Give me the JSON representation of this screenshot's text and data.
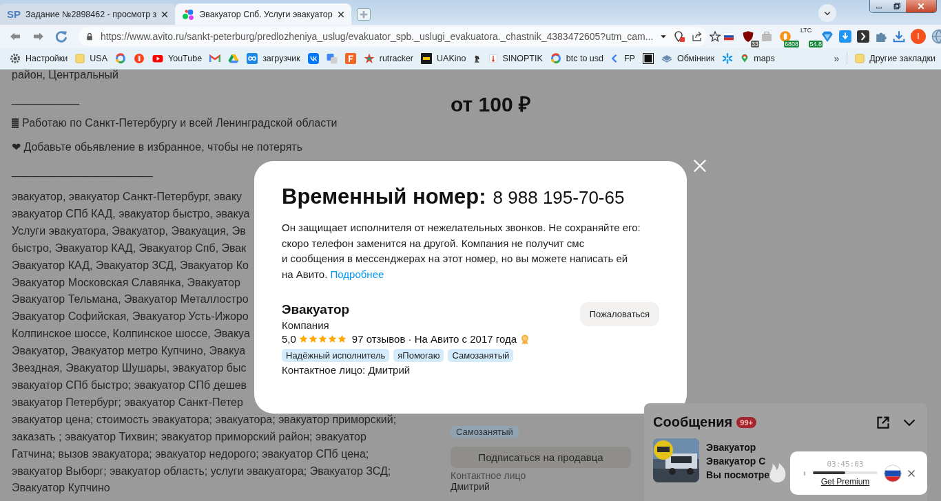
{
  "tabs": [
    {
      "favicon_text": "SP",
      "title": "Задание №2898462 - просмотр з",
      "selected": false
    },
    {
      "title": "Эвакуатор Спб. Услуги эвакуатор",
      "selected": true
    }
  ],
  "address_bar": {
    "url": "https://www.avito.ru/sankt-peterburg/predlozheniya_uslug/evakuator_spb._uslugi_evakuatora._chastnik_4383472605?utm_cam..."
  },
  "extensions": {
    "blocker_count": "33",
    "btc_price": "6808",
    "coin_label": "LTC",
    "coin_price": "54.8",
    "profile_initial": "I"
  },
  "bookmarks": [
    {
      "kind": "link",
      "label": "Настройки"
    },
    {
      "kind": "link",
      "label": "USA"
    },
    {
      "kind": "icon"
    },
    {
      "kind": "icon"
    },
    {
      "kind": "link",
      "label": "YouTube"
    },
    {
      "kind": "icon"
    },
    {
      "kind": "icon"
    },
    {
      "kind": "link",
      "label": "загрузчик"
    },
    {
      "kind": "icon"
    },
    {
      "kind": "icon"
    },
    {
      "kind": "icon"
    },
    {
      "kind": "link",
      "label": "rutracker"
    },
    {
      "kind": "link",
      "label": "UAKino"
    },
    {
      "kind": "icon"
    },
    {
      "kind": "link",
      "label": "SINOPTIK"
    },
    {
      "kind": "link",
      "label": "btc to usd"
    },
    {
      "kind": "link",
      "label": "FP"
    },
    {
      "kind": "icon"
    },
    {
      "kind": "link",
      "label": "Обмінник"
    },
    {
      "kind": "icon"
    },
    {
      "kind": "link",
      "label": "maps"
    }
  ],
  "bookmarks_more": "»",
  "other_bookmarks": "Другие закладки",
  "listing": {
    "intro": [
      {
        "kind": "text",
        "text": "район, Центральный"
      },
      {
        "kind": "text",
        "text": "___________"
      },
      {
        "kind": "note",
        "text": "Работаю по Санкт-Петербургу и всей Ленинградской области"
      },
      {
        "kind": "text",
        "text": "❤ Добавьте обьявление в избранное, чтобы не потерять"
      },
      {
        "kind": "text",
        "text": "_______________________"
      }
    ],
    "keywords": [
      "эвакуатор, эвакуатор Санкт-Петербург, эваку",
      "эвакуатор СПб КАД, эвакуатор быстро, эвакуа",
      "Услуги эвакуатора, Эвакуатор, Эвакуация, Эв",
      "быстро, Эвакуатор КАД, Эвакуатор Спб, Эвак",
      "Эвакуатор КАД, Эвакуатор ЗСД, Эвакуатор Ко",
      "Эвакуатор Московская Славянка, Эвакуатор",
      "Эвакуатор Тельмана, Эвакуатор Металлостро",
      "Эвакуатор Софийская, Эвакуатор Усть-Ижоро",
      "Колпинское шоссе, Колпинское шоссе, Эвакуа",
      "Эвакуатор, Эвакуатор метро Купчино, Эвакуа",
      "Звездная, Эвакуатор Шушары, эвакуатор быс",
      "эвакуатор СПб быстро; эвакуатор СПб дешев",
      "эвакуатор Петербург; эвакуатор Санкт-Петер",
      "эвакуатор цена; стоимость эвакуатора; эвакуатора; эвакуатор приморский;",
      "заказать ; эвакуатор Тихвин; эвакуатор приморский район; эвакуатор",
      "Гатчина; вызов эвакуатора; эвакуатор недорого; эвакуатор СПб цена;",
      "эвакуатор Выборг; эвакуатор область; услуги эвакуатора; Эвакуатор ЗСД;",
      "Эвакуатор Купчино"
    ],
    "price": "от 100 ₽",
    "tag": "Самозанятый",
    "subscribe_button": "Подписаться на продавца",
    "contact_label": "Контактное лицо",
    "contact_name": "Дмитрий"
  },
  "modal": {
    "title": "Временный номер:",
    "phone": "8 988 195-70-65",
    "text": "Он защищает исполнителя от нежелательных звонков. Не сохраняйте его:\nскоро телефон заменится на другой. Компания не получит смс\nи сообщения в мессенджерах на этот номер, но вы можете написать ей\nна Авито.",
    "link": "Подробнее",
    "seller": {
      "name": "Эвакуатор",
      "type": "Компания",
      "rating": "5,0",
      "stars": 5,
      "reviews": "97 отзывов · На Авито с 2017 года",
      "badges": [
        "Надёжный исполнитель",
        "яПомогаю",
        "Самозанятый"
      ],
      "contact": "Контактное лицо: Дмитрий"
    },
    "report_button": "Пожаловаться"
  },
  "messages": {
    "title": "Сообщения",
    "count": "99+",
    "chats": [
      {
        "name": "Эвакуатор",
        "title": "Эвакуатор С",
        "preview": "Вы посмотре"
      }
    ]
  },
  "player": {
    "time": "03:45:03",
    "level": 0.5,
    "link": "Get Premium"
  }
}
